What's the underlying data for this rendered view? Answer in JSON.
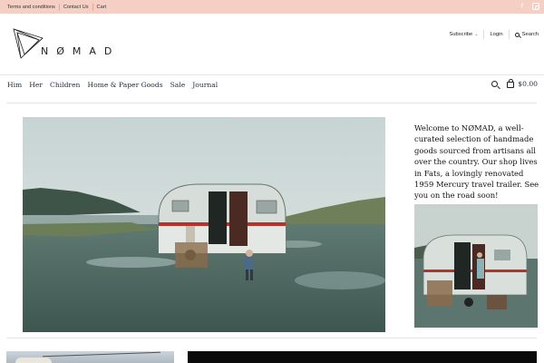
{
  "topbar": {
    "links": [
      "Terms and conditions",
      "Contact Us",
      "Cart"
    ],
    "social_icons": [
      "facebook-icon",
      "instagram-icon"
    ]
  },
  "header": {
    "logo_text": "NØMAD",
    "subscribe_label": "Subscribe",
    "login_label": "Login",
    "search_label": "Search"
  },
  "nav": {
    "items": [
      "Him",
      "Her",
      "Children",
      "Home & Paper Goods",
      "Sale",
      "Journal"
    ],
    "cart_total": "$0.00"
  },
  "main": {
    "welcome_text": "Welcome to NØMAD, a well-curated selection of handmade goods sourced from artisans all over the country. Our shop lives in Fats, a lovingly renovated 1959 Mercury travel trailer. See you on the road soon!"
  },
  "colors": {
    "topbar_bg": "#f6cfc4",
    "nav_text": "#1f2b3d",
    "trailer_red": "#b8322c"
  }
}
